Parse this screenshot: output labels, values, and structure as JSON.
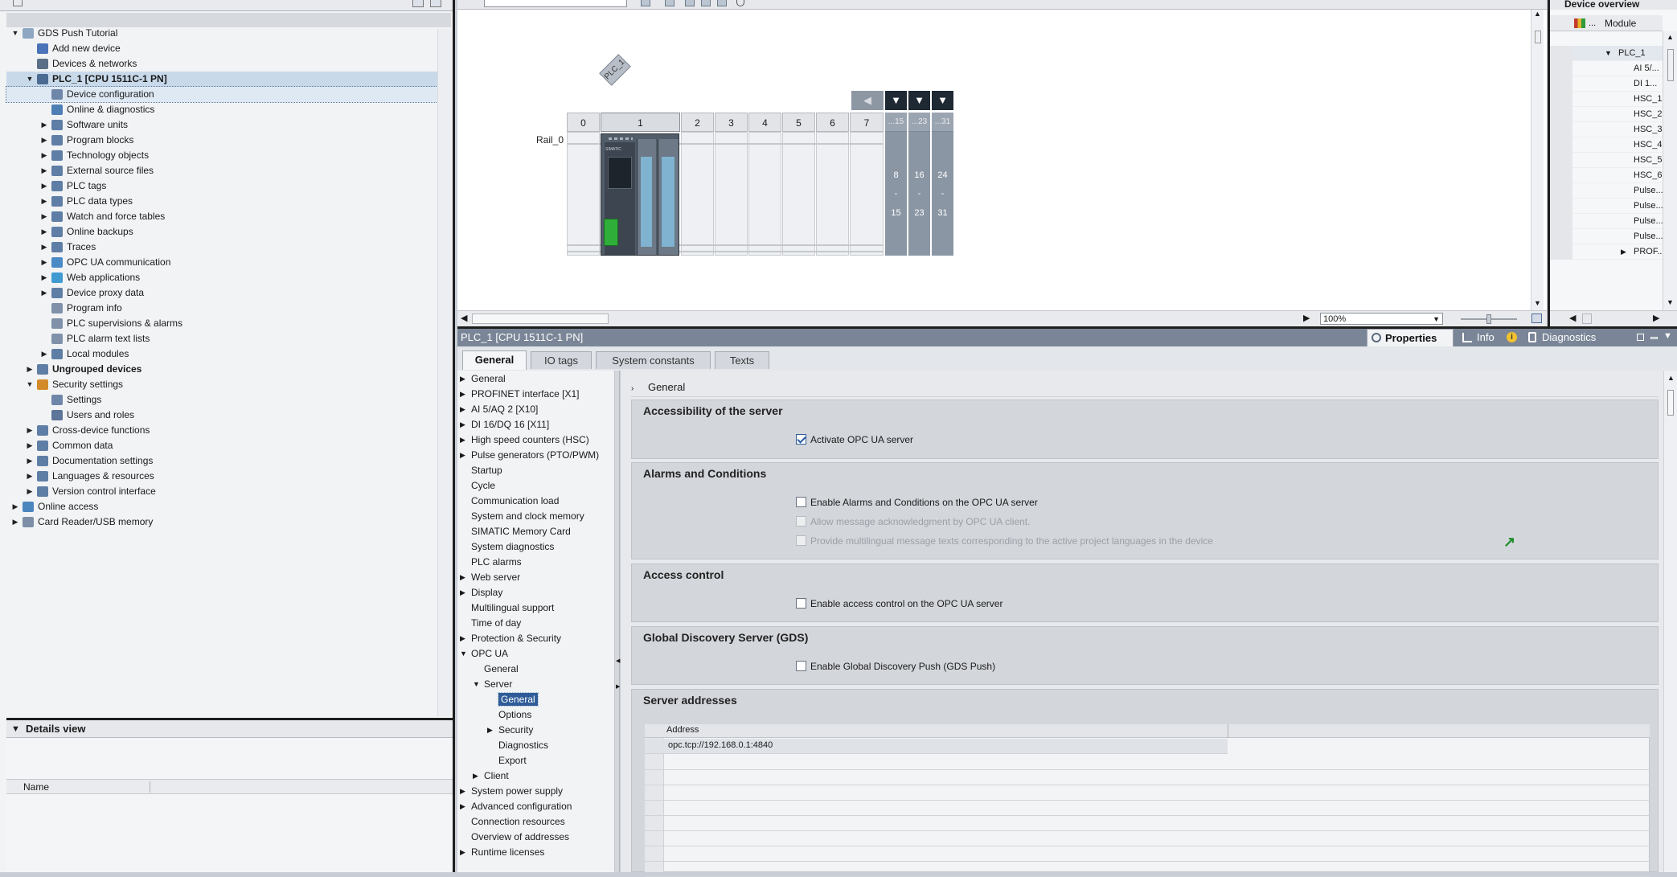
{
  "project_tree": {
    "items": [
      {
        "label": "GDS Push Tutorial",
        "indent": 0,
        "twisty": "open",
        "icon": "project-icon"
      },
      {
        "label": "Add new device",
        "indent": 1,
        "twisty": "",
        "icon": "add-device-icon"
      },
      {
        "label": "Devices & networks",
        "indent": 1,
        "twisty": "",
        "icon": "network-icon"
      },
      {
        "label": "PLC_1 [CPU 1511C-1 PN]",
        "indent": 1,
        "twisty": "open",
        "icon": "plc-icon",
        "bold": true,
        "selected": true
      },
      {
        "label": "Device configuration",
        "indent": 2,
        "twisty": "",
        "icon": "device-config-icon",
        "focused": true
      },
      {
        "label": "Online & diagnostics",
        "indent": 2,
        "twisty": "",
        "icon": "diagnostics-icon"
      },
      {
        "label": "Software units",
        "indent": 2,
        "twisty": "closed",
        "icon": "folder-icon"
      },
      {
        "label": "Program blocks",
        "indent": 2,
        "twisty": "closed",
        "icon": "folder-icon"
      },
      {
        "label": "Technology objects",
        "indent": 2,
        "twisty": "closed",
        "icon": "folder-icon"
      },
      {
        "label": "External source files",
        "indent": 2,
        "twisty": "closed",
        "icon": "folder-icon"
      },
      {
        "label": "PLC tags",
        "indent": 2,
        "twisty": "closed",
        "icon": "folder-icon"
      },
      {
        "label": "PLC data types",
        "indent": 2,
        "twisty": "closed",
        "icon": "folder-icon"
      },
      {
        "label": "Watch and force tables",
        "indent": 2,
        "twisty": "closed",
        "icon": "folder-icon"
      },
      {
        "label": "Online backups",
        "indent": 2,
        "twisty": "closed",
        "icon": "folder-icon"
      },
      {
        "label": "Traces",
        "indent": 2,
        "twisty": "closed",
        "icon": "folder-icon"
      },
      {
        "label": "OPC UA communication",
        "indent": 2,
        "twisty": "closed",
        "icon": "opcua-icon"
      },
      {
        "label": "Web applications",
        "indent": 2,
        "twisty": "closed",
        "icon": "web-icon"
      },
      {
        "label": "Device proxy data",
        "indent": 2,
        "twisty": "closed",
        "icon": "folder-icon"
      },
      {
        "label": "Program info",
        "indent": 2,
        "twisty": "",
        "icon": "info-doc-icon"
      },
      {
        "label": "PLC supervisions & alarms",
        "indent": 2,
        "twisty": "",
        "icon": "alarm-doc-icon"
      },
      {
        "label": "PLC alarm text lists",
        "indent": 2,
        "twisty": "",
        "icon": "text-list-icon"
      },
      {
        "label": "Local modules",
        "indent": 2,
        "twisty": "closed",
        "icon": "folder-icon"
      },
      {
        "label": "Ungrouped devices",
        "indent": 1,
        "twisty": "closed",
        "icon": "folder-icon",
        "bold": true
      },
      {
        "label": "Security settings",
        "indent": 1,
        "twisty": "open",
        "icon": "security-icon"
      },
      {
        "label": "Settings",
        "indent": 2,
        "twisty": "",
        "icon": "settings-icon"
      },
      {
        "label": "Users and roles",
        "indent": 2,
        "twisty": "",
        "icon": "users-icon"
      },
      {
        "label": "Cross-device functions",
        "indent": 1,
        "twisty": "closed",
        "icon": "folder-icon"
      },
      {
        "label": "Common data",
        "indent": 1,
        "twisty": "closed",
        "icon": "folder-icon"
      },
      {
        "label": "Documentation settings",
        "indent": 1,
        "twisty": "closed",
        "icon": "folder-icon"
      },
      {
        "label": "Languages & resources",
        "indent": 1,
        "twisty": "closed",
        "icon": "folder-icon"
      },
      {
        "label": "Version control interface",
        "indent": 1,
        "twisty": "closed",
        "icon": "folder-icon"
      },
      {
        "label": "Online access",
        "indent": 0,
        "twisty": "closed",
        "icon": "online-icon"
      },
      {
        "label": "Card Reader/USB memory",
        "indent": 0,
        "twisty": "closed",
        "icon": "usb-icon"
      }
    ]
  },
  "details_view": {
    "title": "Details view",
    "column_name": "Name"
  },
  "device_view": {
    "device_label": "PLC_1",
    "rail_label": "Rail_0",
    "slots": [
      "0",
      "1",
      "2",
      "3",
      "4",
      "5",
      "6",
      "7"
    ],
    "expansion_headers": [
      "...15",
      "...23",
      "...31"
    ],
    "expansion_ranges": [
      {
        "from": "8",
        "dash": "-",
        "to": "15"
      },
      {
        "from": "16",
        "dash": "-",
        "to": "23"
      },
      {
        "from": "24",
        "dash": "-",
        "to": "31"
      }
    ],
    "zoom": "100%",
    "cpu_brand": "SIMATIC"
  },
  "device_overview": {
    "title": "Device overview",
    "column_module": "Module",
    "column_dots": "...",
    "rows": [
      "PLC_1",
      "AI 5/...",
      "DI 1...",
      "HSC_1",
      "HSC_2",
      "HSC_3",
      "HSC_4",
      "HSC_5",
      "HSC_6",
      "Pulse...",
      "Pulse...",
      "Pulse...",
      "Pulse...",
      "PROF..."
    ]
  },
  "inspector": {
    "title": "PLC_1 [CPU 1511C-1 PN]",
    "tabs": {
      "properties": "Properties",
      "info": "Info",
      "diagnostics": "Diagnostics"
    },
    "prop_tabs": [
      "General",
      "IO tags",
      "System constants",
      "Texts"
    ],
    "nav": [
      {
        "label": "General",
        "level": 0,
        "twisty": "closed"
      },
      {
        "label": "PROFINET interface [X1]",
        "level": 0,
        "twisty": "closed"
      },
      {
        "label": "AI 5/AQ 2 [X10]",
        "level": 0,
        "twisty": "closed"
      },
      {
        "label": "DI 16/DQ 16 [X11]",
        "level": 0,
        "twisty": "closed"
      },
      {
        "label": "High speed counters (HSC)",
        "level": 0,
        "twisty": "closed"
      },
      {
        "label": "Pulse generators (PTO/PWM)",
        "level": 0,
        "twisty": "closed"
      },
      {
        "label": "Startup",
        "level": 0,
        "twisty": ""
      },
      {
        "label": "Cycle",
        "level": 0,
        "twisty": ""
      },
      {
        "label": "Communication load",
        "level": 0,
        "twisty": ""
      },
      {
        "label": "System and clock memory",
        "level": 0,
        "twisty": ""
      },
      {
        "label": "SIMATIC Memory Card",
        "level": 0,
        "twisty": ""
      },
      {
        "label": "System diagnostics",
        "level": 0,
        "twisty": ""
      },
      {
        "label": "PLC alarms",
        "level": 0,
        "twisty": ""
      },
      {
        "label": "Web server",
        "level": 0,
        "twisty": "closed"
      },
      {
        "label": "Display",
        "level": 0,
        "twisty": "closed"
      },
      {
        "label": "Multilingual support",
        "level": 0,
        "twisty": ""
      },
      {
        "label": "Time of day",
        "level": 0,
        "twisty": ""
      },
      {
        "label": "Protection & Security",
        "level": 0,
        "twisty": "closed"
      },
      {
        "label": "OPC UA",
        "level": 0,
        "twisty": "open"
      },
      {
        "label": "General",
        "level": 1,
        "twisty": ""
      },
      {
        "label": "Server",
        "level": 1,
        "twisty": "open"
      },
      {
        "label": "General",
        "level": 2,
        "twisty": "",
        "selected": true
      },
      {
        "label": "Options",
        "level": 2,
        "twisty": ""
      },
      {
        "label": "Security",
        "level": 2,
        "twisty": "closed"
      },
      {
        "label": "Diagnostics",
        "level": 2,
        "twisty": ""
      },
      {
        "label": "Export",
        "level": 2,
        "twisty": ""
      },
      {
        "label": "Client",
        "level": 1,
        "twisty": "closed"
      },
      {
        "label": "System power supply",
        "level": 0,
        "twisty": "closed"
      },
      {
        "label": "Advanced configuration",
        "level": 0,
        "twisty": "closed"
      },
      {
        "label": "Connection resources",
        "level": 0,
        "twisty": ""
      },
      {
        "label": "Overview of addresses",
        "level": 0,
        "twisty": ""
      },
      {
        "label": "Runtime licenses",
        "level": 0,
        "twisty": "closed"
      }
    ],
    "content": {
      "breadcrumb": "General",
      "sections": {
        "accessibility": {
          "title": "Accessibility of the server",
          "activate": {
            "label": "Activate OPC UA server",
            "checked": true
          }
        },
        "alarms": {
          "title": "Alarms and Conditions",
          "enable": {
            "label": "Enable Alarms and Conditions on the OPC UA server",
            "checked": false
          },
          "ack": {
            "label": "Allow message acknowledgment by OPC UA client.",
            "disabled": true
          },
          "multilingual": {
            "label": "Provide multilingual message texts corresponding to the active project languages in the device",
            "disabled": true
          }
        },
        "access": {
          "title": "Access control",
          "enable": {
            "label": "Enable access control on the OPC UA server",
            "checked": false
          }
        },
        "gds": {
          "title": "Global Discovery Server (GDS)",
          "enable": {
            "label": "Enable Global Discovery Push (GDS Push)",
            "checked": false
          }
        },
        "addresses": {
          "title": "Server addresses",
          "column": "Address",
          "rows": [
            "opc.tcp://192.168.0.1:4840"
          ]
        }
      }
    }
  },
  "colors": {
    "panel_dark": "#7a8697",
    "selection": "#2f5c98",
    "cpu_green": "#2fae3a",
    "cpu_body": "#4b5561",
    "link_green": "#1e8f2a"
  }
}
